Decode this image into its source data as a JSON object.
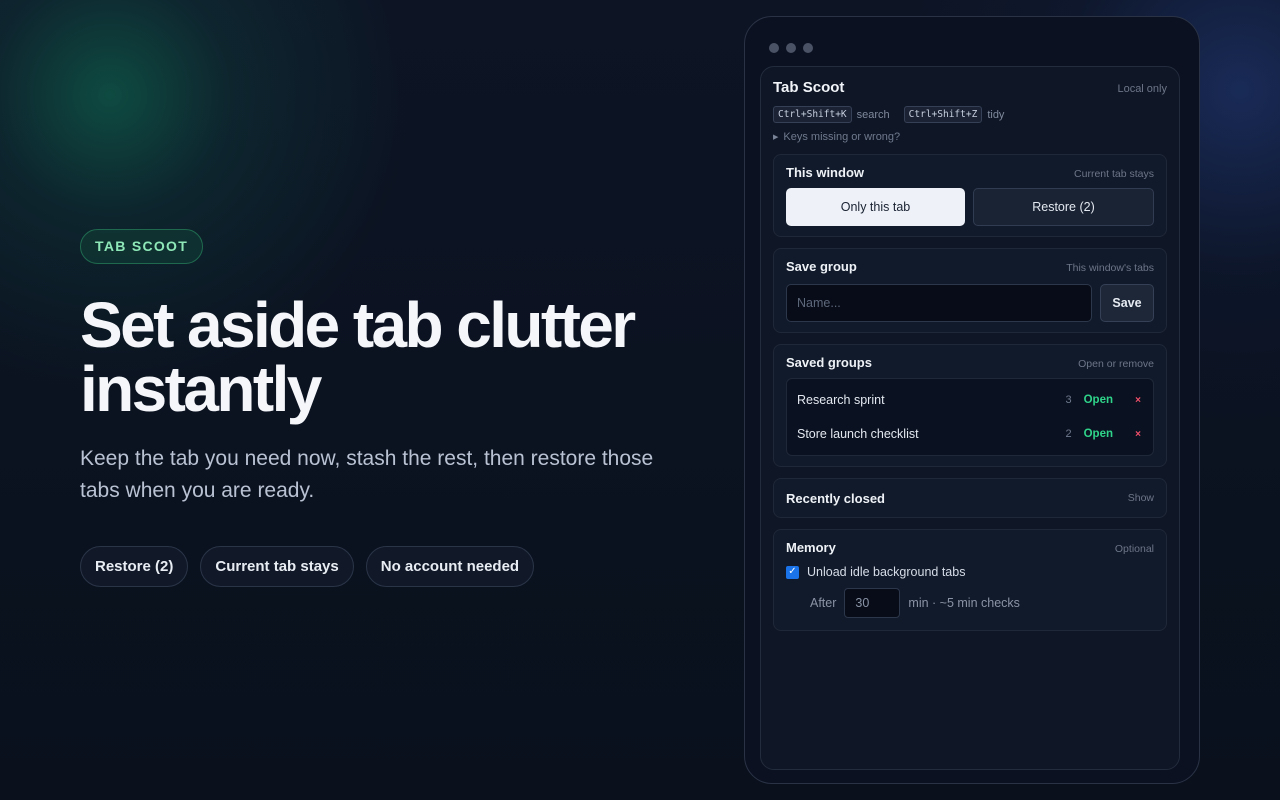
{
  "hero": {
    "badge": "TAB SCOOT",
    "headline_line1": "Set aside tab clutter",
    "headline_line2": "instantly",
    "subhead": "Keep the tab you need now, stash the rest, then restore those tabs when you are ready.",
    "pills": [
      "Restore (2)",
      "Current tab stays",
      "No account needed"
    ]
  },
  "popup": {
    "title": "Tab Scoot",
    "local_note": "Local only",
    "shortcuts": {
      "search_key": "Ctrl+Shift+K",
      "search_label": "search",
      "tidy_key": "Ctrl+Shift+Z",
      "tidy_label": "tidy"
    },
    "keys_missing": "Keys missing or wrong?",
    "this_window": {
      "title": "This window",
      "note": "Current tab stays",
      "only_this_tab": "Only this tab",
      "restore": "Restore (2)"
    },
    "save_group": {
      "title": "Save group",
      "note": "This window's tabs",
      "placeholder": "Name...",
      "value": "",
      "save_label": "Save"
    },
    "saved_groups": {
      "title": "Saved groups",
      "note": "Open or remove",
      "items": [
        {
          "name": "Research sprint",
          "count": "3",
          "open": "Open",
          "remove": "×"
        },
        {
          "name": "Store launch checklist",
          "count": "2",
          "open": "Open",
          "remove": "×"
        }
      ]
    },
    "recently_closed": {
      "title": "Recently closed",
      "toggle": "Show"
    },
    "memory": {
      "title": "Memory",
      "note": "Optional",
      "unload_label": "Unload idle background tabs",
      "unload_checked": true,
      "after_label": "After",
      "after_value": "30",
      "after_suffix": "min · ~5 min checks"
    }
  },
  "colors": {
    "accent_green": "#2fd48a",
    "danger_red": "#f0506a",
    "badge_green": "#8ee8b8",
    "checkbox_blue": "#1a73e8"
  }
}
